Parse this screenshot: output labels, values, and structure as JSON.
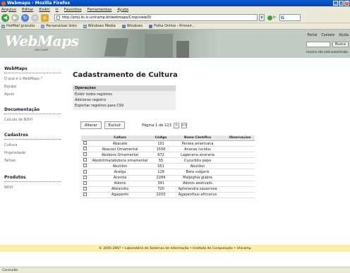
{
  "browser": {
    "title": "Webmaps - Mozilla Firefox",
    "menu": [
      "Arquivo",
      "Editar",
      "Exibir",
      "Ir",
      "Favoritos",
      "Ferramentas",
      "Ajuda"
    ],
    "url": "http://proj.lis.ic.unicamp.br/webmaps/Crop/view/0/",
    "search_value": "G",
    "bookmarks": [
      "HotMail gratuito",
      "Personalizar links",
      "Windows Media",
      "Windows",
      "Folha Online - Primeir..."
    ],
    "status": "Concluído"
  },
  "header": {
    "logo": "WebMaps",
    "logo_sub": "UNICAMP",
    "links": [
      "Portal",
      "Contato",
      "Ajuda"
    ],
    "search_button": "Busca",
    "auth_note": "Usuário não está autenticado."
  },
  "sidebar": [
    {
      "title": "WebMaps",
      "items": [
        "O que é o WebMaps ?",
        "Equipe",
        "Apoio"
      ]
    },
    {
      "title": "Documentação",
      "items": [
        "Cálculo do NDVI"
      ]
    },
    {
      "title": "Cadastros",
      "items": [
        "Cultura",
        "Propriedade",
        "Talhão"
      ]
    },
    {
      "title": "Produtos",
      "items": [
        "NDVI"
      ]
    }
  ],
  "main": {
    "title": "Cadastramento de Cultura",
    "ops_title": "Operações",
    "ops": [
      "Exibir todos registros",
      "Adicionar registro",
      "Exportar registros para CSV"
    ],
    "alter_button": "Alterar",
    "delete_button": "Excluir",
    "pager_text": "Página 1 de 123",
    "next_label": ">",
    "last_label": ">>",
    "columns": [
      "Cultura",
      "Código",
      "Nome Científico",
      "Observações"
    ],
    "rows": [
      [
        "Abacate",
        "101",
        "Persea americana",
        ""
      ],
      [
        "Abacaxi Ornamental",
        "1558",
        "Ananas lucidus",
        ""
      ],
      [
        "Abobora Ornamental",
        "672",
        "Lagenaria siceraria",
        ""
      ],
      [
        "Abobrinha/abobora ornamental",
        "55",
        "Cucurbita pepo",
        ""
      ],
      [
        "Abutilon",
        "551",
        "Abutilon",
        ""
      ],
      [
        "Acelga",
        "128",
        "Beta vulgaris",
        ""
      ],
      [
        "Acerola",
        "2284",
        "Malpighia glabra",
        ""
      ],
      [
        "Adonis",
        "341",
        "Adonis aestivalis",
        ""
      ],
      [
        "Afelandra",
        "720",
        "Aphelandra squarrosa",
        ""
      ],
      [
        "Agapanto",
        "2203",
        "Agapanthus africanus",
        ""
      ]
    ]
  },
  "footer": "© 2005-2007 • Laboratório de Sistemas de Informação • Instituto de Computação • Unicamp"
}
